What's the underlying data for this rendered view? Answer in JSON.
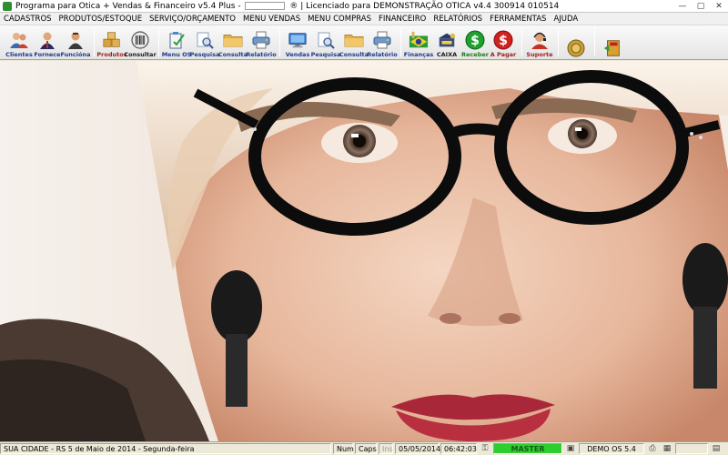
{
  "window": {
    "title_prefix": "Programa para Otica + Vendas & Financeiro v5.4 Plus -",
    "title_suffix": "® | Licenciado para  DEMONSTRAÇÃO OTICA v4.4 300914 010514",
    "controls": [
      "—",
      "▢",
      "✕"
    ]
  },
  "menu": [
    "CADASTROS",
    "PRODUTOS/ESTOQUE",
    "SERVIÇO/ORÇAMENTO",
    "MENU VENDAS",
    "MENU COMPRAS",
    "FINANCEIRO",
    "RELATÓRIOS",
    "FERRAMENTAS",
    "AJUDA"
  ],
  "toolbar": {
    "group1": [
      {
        "label": "Clientes",
        "icon": "people-icon",
        "color": "#e7a56a"
      },
      {
        "label": "Fornece",
        "icon": "supplier-icon",
        "color": "#d48a50"
      },
      {
        "label": "Funcióna",
        "icon": "employee-icon",
        "color": "#c97a42"
      }
    ],
    "group2": [
      {
        "label": "Produtos",
        "icon": "boxes-icon",
        "color": "#d9a040"
      },
      {
        "label": "Consultar",
        "icon": "barcode-icon",
        "color": "#9a9a9a"
      }
    ],
    "group3": [
      {
        "label": "Menu OS",
        "icon": "clipboard-icon",
        "color": "#4a8ac4"
      },
      {
        "label": "Pesquisa",
        "icon": "magnifier-icon",
        "color": "#9ab8d8"
      },
      {
        "label": "Consulta",
        "icon": "folder-icon",
        "color": "#e0b050"
      },
      {
        "label": "Relatório",
        "icon": "printer-icon",
        "color": "#6a9ad0"
      }
    ],
    "group4": [
      {
        "label": "Vendas",
        "icon": "monitor-icon",
        "color": "#5a9ae0"
      },
      {
        "label": "Pesquisa",
        "icon": "magnifier-icon",
        "color": "#9ab8d8"
      },
      {
        "label": "Consulta",
        "icon": "folder-icon",
        "color": "#e0b050"
      },
      {
        "label": "Relatório",
        "icon": "printer-icon",
        "color": "#6a9ad0"
      }
    ],
    "group5": [
      {
        "label": "Finanças",
        "icon": "brazil-flag-icon",
        "color": "#2a9a3a"
      },
      {
        "label": "CAIXA",
        "icon": "cash-register-icon",
        "color": "#2a3a6a"
      },
      {
        "label": "Receber",
        "icon": "dollar-green-icon",
        "color": "#1fa030"
      },
      {
        "label": "A Pagar",
        "icon": "dollar-red-icon",
        "color": "#d02020"
      }
    ],
    "group6": [
      {
        "label": "Suporte",
        "icon": "support-agent-icon",
        "color": "#c83020"
      }
    ],
    "group7": [
      {
        "label": "",
        "icon": "coins-icon",
        "color": "#c8a040"
      },
      {
        "label": "",
        "icon": "exit-icon",
        "color": "#d8a030"
      }
    ]
  },
  "status": {
    "city": "SUA CIDADE - RS  5 de Maio de 2014 - Segunda-feira",
    "num": "Num",
    "caps": "Caps",
    "ins": "Ins",
    "date": "05/05/2014",
    "time": "06:42:03",
    "user": "MASTER",
    "version": "DEMO OS 5.4"
  }
}
